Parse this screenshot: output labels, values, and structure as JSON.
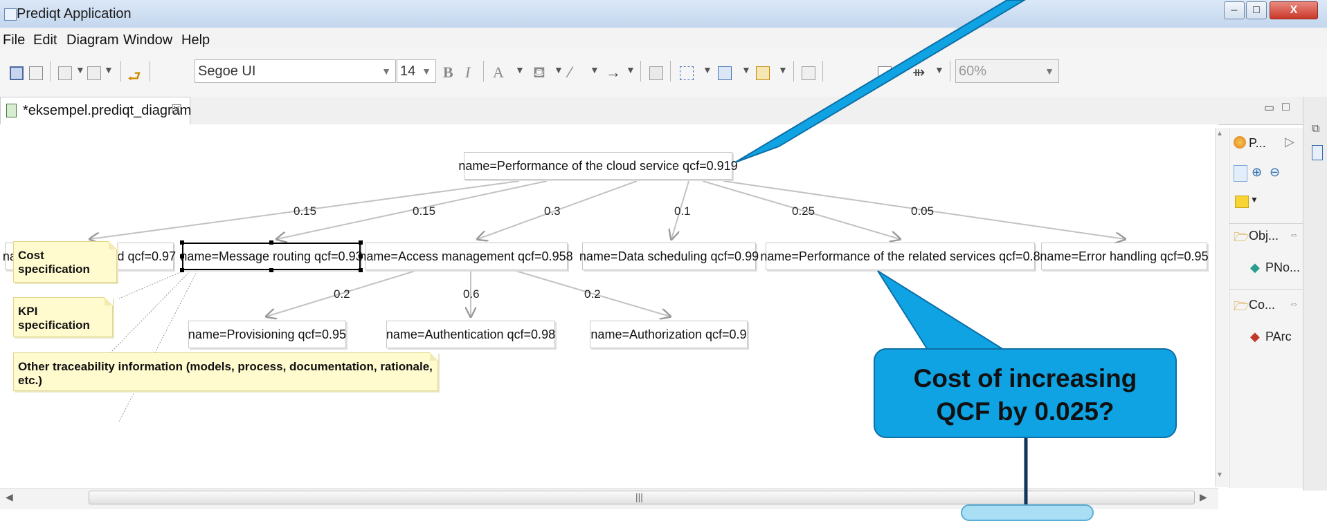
{
  "window": {
    "title": "Prediqt Application",
    "minimize": "–",
    "maximize": "□",
    "close": "X"
  },
  "menu": [
    "File",
    "Edit",
    "Diagram",
    "Window",
    "Help"
  ],
  "toolbar": {
    "font_family": "Segoe UI",
    "font_size": "14",
    "bold": "B",
    "italic": "I",
    "font_color": "A",
    "zoom": "60%"
  },
  "editor_tab": {
    "label": "*eksempel.prediqt_diagram",
    "close": "☒"
  },
  "diagram": {
    "nodes": {
      "root": "name=Performance of the cloud service qcf=0.919",
      "network": "name=Network speed qcf=0.97",
      "routing": "name=Message routing qcf=0.93",
      "access": "name=Access management qcf=0.958",
      "scheduling": "name=Data scheduling qcf=0.99",
      "related": "name=Performance of the related services qcf=0.8",
      "error": "name=Error handling qcf=0.95",
      "provisioning": "name=Provisioning qcf=0.95",
      "authentication": "name=Authentication qcf=0.98",
      "authorization": "name=Authorization qcf=0.9"
    },
    "weights": {
      "network": "0.15",
      "routing": "0.15",
      "access": "0.3",
      "scheduling": "0.1",
      "related": "0.25",
      "error": "0.05",
      "provisioning": "0.2",
      "authentication": "0.6",
      "authorization": "0.2"
    },
    "notes": {
      "cost": "Cost specification",
      "kpi": "KPI specification",
      "trace": "Other traceability information (models, process, documentation, rationale, etc.)"
    }
  },
  "palette": {
    "header": "P...",
    "objects_folder": "Obj...",
    "object_item": "PNo...",
    "connections_folder": "Co...",
    "connection_item": "PArc"
  },
  "callout": {
    "line1": "Cost of increasing",
    "line2": "QCF by 0.025?"
  },
  "colors": {
    "callout_fill": "#0fa3e3",
    "note_fill": "#fffbcf",
    "selection": "#000000"
  }
}
